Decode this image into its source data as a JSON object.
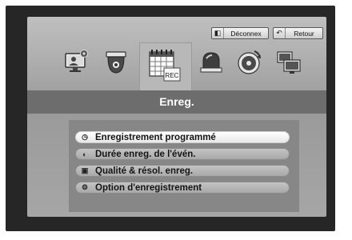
{
  "top_buttons": {
    "logout": {
      "label": "Déconnex",
      "icon": "logout-icon"
    },
    "back": {
      "label": "Retour",
      "icon": "back-arrow-icon"
    }
  },
  "toolbar": {
    "icons": [
      "monitor-settings-icon",
      "dome-camera-icon",
      "record-calendar-icon",
      "alarm-siren-icon",
      "disk-backup-icon",
      "network-monitors-icon"
    ],
    "selected": "record-calendar-icon",
    "rec_tag": "REC"
  },
  "title": "Enreg.",
  "menu": [
    {
      "label": "Enregistrement programmé",
      "icon": "clock-icon",
      "active": true
    },
    {
      "label": "Durée enreg. de l'évén.",
      "icon": "event-duration-icon",
      "active": false
    },
    {
      "label": "Qualité & résol. enreg.",
      "icon": "image-quality-icon",
      "active": false
    },
    {
      "label": "Option d'enregistrement",
      "icon": "gear-icon",
      "active": false
    }
  ]
}
